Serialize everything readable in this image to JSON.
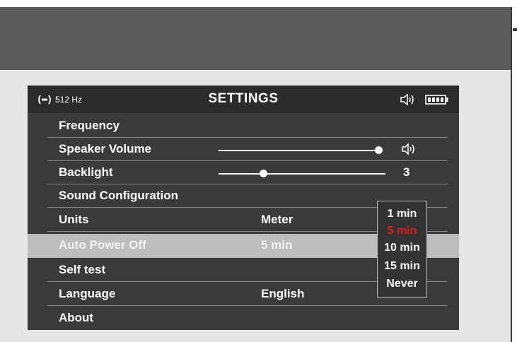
{
  "status_bar": {
    "frequency": "512 Hz",
    "title": "SETTINGS",
    "icons": [
      "signal-icon",
      "speaker-icon",
      "battery-icon"
    ]
  },
  "menu": [
    {
      "label": "Frequency",
      "value": ""
    },
    {
      "label": "Speaker Volume",
      "value": "",
      "control": "slider",
      "level": 0.98,
      "icon": "speaker-icon"
    },
    {
      "label": "Backlight",
      "value": "3",
      "control": "slider",
      "level": 0.27
    },
    {
      "label": "Sound Configuration",
      "value": ""
    },
    {
      "label": "Units",
      "value": "Meter"
    },
    {
      "label": "Auto Power Off",
      "value": "5 min",
      "selected": true
    },
    {
      "label": "Self test",
      "value": ""
    },
    {
      "label": "Language",
      "value": "English"
    },
    {
      "label": "About",
      "value": ""
    }
  ],
  "dropdown": {
    "options": [
      "1 min",
      "5 min",
      "10 min",
      "15 min",
      "Never"
    ],
    "selected": "5 min",
    "selected_color": "#d62020"
  },
  "colors": {
    "screen_bg": "#3a3a3a",
    "selected_row_bg": "#bdbdbd",
    "header_band": "#5b5b5b"
  }
}
